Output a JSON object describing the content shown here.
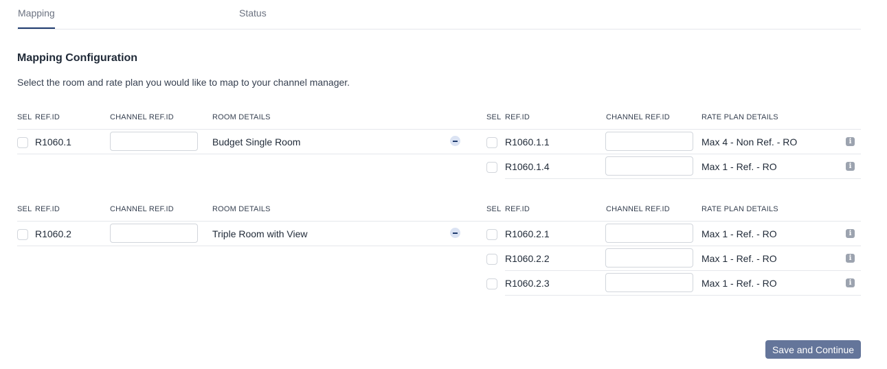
{
  "tabs": [
    {
      "label": "Mapping",
      "active": true
    },
    {
      "label": "Status",
      "active": false
    }
  ],
  "title": "Mapping Configuration",
  "description": "Select the room and rate plan you would like to map to your channel manager.",
  "headers": {
    "sel": "SEL",
    "ref": "REF.ID",
    "channel": "CHANNEL REF.ID",
    "room": "ROOM DETAILS",
    "rate": "RATE PLAN DETAILS"
  },
  "info_glyph": "i",
  "groups": [
    {
      "ref": "R1060.1",
      "room": "Budget Single Room",
      "channel_ref": "",
      "rates": [
        {
          "ref": "R1060.1.1",
          "details": "Max 4 - Non Ref. - RO",
          "channel_ref": ""
        },
        {
          "ref": "R1060.1.4",
          "details": "Max 1 - Ref. - RO",
          "channel_ref": ""
        }
      ]
    },
    {
      "ref": "R1060.2",
      "room": "Triple Room with View",
      "channel_ref": "",
      "rates": [
        {
          "ref": "R1060.2.1",
          "details": "Max 1 - Ref. - RO",
          "channel_ref": ""
        },
        {
          "ref": "R1060.2.2",
          "details": "Max 1 - Ref. - RO",
          "channel_ref": ""
        },
        {
          "ref": "R1060.2.3",
          "details": "Max 1 - Ref. - RO",
          "channel_ref": ""
        }
      ]
    }
  ],
  "save_label": "Save and Continue"
}
